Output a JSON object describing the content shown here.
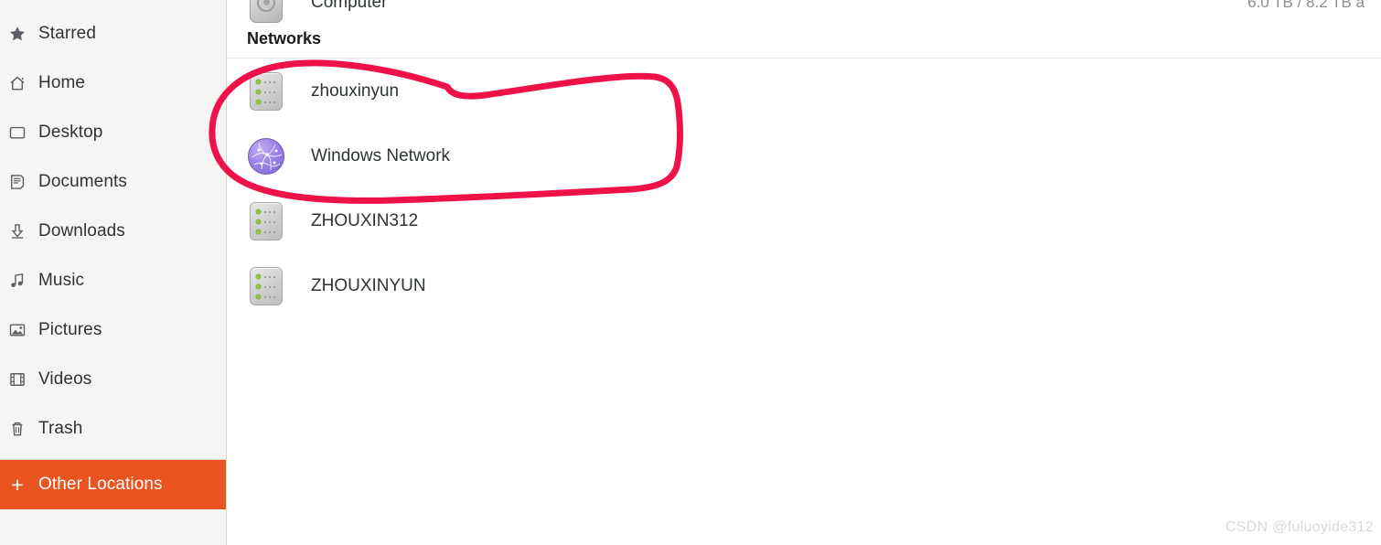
{
  "sidebar": {
    "items": [
      {
        "label": "Starred",
        "icon": "star-icon",
        "active": false
      },
      {
        "label": "Home",
        "icon": "home-icon",
        "active": false
      },
      {
        "label": "Desktop",
        "icon": "desktop-icon",
        "active": false
      },
      {
        "label": "Documents",
        "icon": "documents-icon",
        "active": false
      },
      {
        "label": "Downloads",
        "icon": "downloads-icon",
        "active": false
      },
      {
        "label": "Music",
        "icon": "music-icon",
        "active": false
      },
      {
        "label": "Pictures",
        "icon": "pictures-icon",
        "active": false
      },
      {
        "label": "Videos",
        "icon": "videos-icon",
        "active": false
      },
      {
        "label": "Trash",
        "icon": "trash-icon",
        "active": false
      }
    ],
    "other_locations": {
      "label": "Other Locations",
      "icon": "plus-icon",
      "plus": "+",
      "active": true,
      "accent_color": "#e95420"
    }
  },
  "main": {
    "computer_row": {
      "label": "Computer",
      "icon": "disk-icon",
      "capacity": "6.0 TB / 8.2 TB a"
    },
    "networks_section": {
      "header": "Networks",
      "items": [
        {
          "label": "zhouxinyun",
          "icon": "server-icon"
        },
        {
          "label": "Windows Network",
          "icon": "network-globe-icon"
        },
        {
          "label": "ZHOUXIN312",
          "icon": "server-icon"
        },
        {
          "label": "ZHOUXINYUN",
          "icon": "server-icon"
        }
      ]
    }
  },
  "annotation": {
    "type": "hand-drawn-circle",
    "color": "#ef1249",
    "stroke_width": 7,
    "encircles": "zhouxinyun"
  },
  "watermark": {
    "text": "CSDN @fuluoyide312"
  }
}
